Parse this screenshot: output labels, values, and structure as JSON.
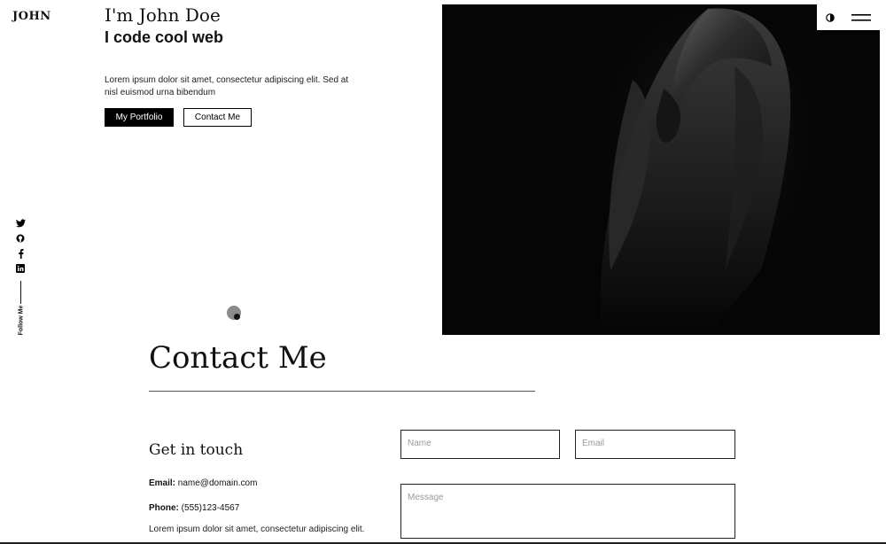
{
  "brand": {
    "logo_text": "JOHN"
  },
  "hero": {
    "intro": "I'm John Doe",
    "tagline": "I code cool web",
    "description": "Lorem ipsum dolor sit amet, consectetur adipiscing elit. Sed at nisl euismod urna bibendum",
    "primary_button": "My Portfolio",
    "secondary_button": "Contact Me",
    "image_subject": "dark hooded figure photo"
  },
  "controls": {
    "theme_icon": "half-circle-contrast-icon",
    "menu_icon": "hamburger-menu-icon"
  },
  "social": {
    "icons": [
      "twitter-icon",
      "github-icon",
      "facebook-icon",
      "linkedin-icon"
    ],
    "follow_label": "Follow Me"
  },
  "contact": {
    "title": "Contact Me",
    "subtitle": "Get in touch",
    "email_label": "Email:",
    "email_value": "name@domain.com",
    "phone_label": "Phone:",
    "phone_value": "(555)123-4567",
    "description": "Lorem ipsum dolor sit amet, consectetur adipiscing elit.",
    "name_placeholder": "Name",
    "email_placeholder": "Email",
    "message_placeholder": "Message"
  },
  "colors": {
    "background": "#ffffff",
    "text": "#111111",
    "primary_button_bg": "#000000",
    "hero_image_bg": "#050505"
  }
}
